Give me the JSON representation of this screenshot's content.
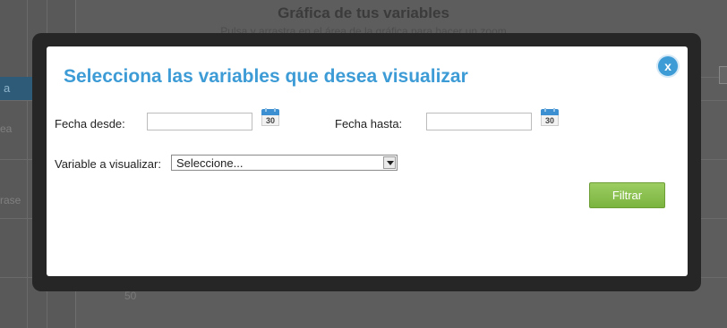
{
  "background": {
    "title": "Gráfica de tus variables",
    "subtitle": "Pulsa y arrastra en el área de la gráfica para hacer un zoom",
    "tab_label": "a",
    "side_labels": [
      "ea",
      "rase"
    ],
    "axis_value": "50"
  },
  "modal": {
    "title": "Selecciona las variables que desea visualizar",
    "close_label": "x",
    "date_from": {
      "label": "Fecha desde:",
      "value": "",
      "icon": "calendar-icon",
      "icon_text": "30"
    },
    "date_to": {
      "label": "Fecha hasta:",
      "value": "",
      "icon": "calendar-icon",
      "icon_text": "30"
    },
    "variable": {
      "label": "Variable a visualizar:",
      "selected": "Seleccione..."
    },
    "filter_button": "Filtrar"
  },
  "colors": {
    "accent": "#3d9bd6",
    "button_green": "#8cc152",
    "overlay": "#262626"
  }
}
